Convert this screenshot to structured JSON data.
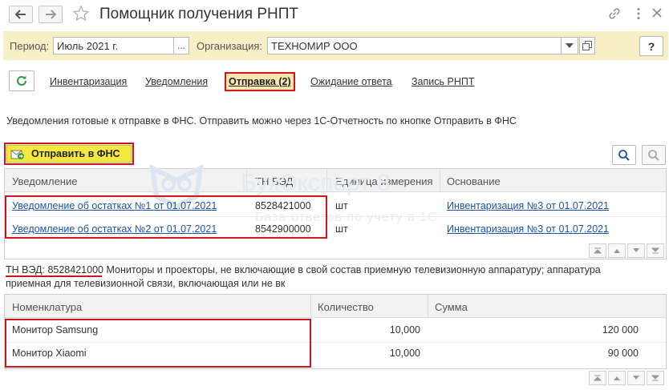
{
  "window": {
    "title": "Помощник получения РНПТ"
  },
  "filters": {
    "period_label": "Период:",
    "period_value": "Июль 2021 г.",
    "period_btn": "...",
    "org_label": "Организация:",
    "org_value": "ТЕХНОМИР ООО",
    "help_btn": "?"
  },
  "tabs": [
    {
      "label": "Инвентаризация"
    },
    {
      "label": "Уведомления"
    },
    {
      "label": "Отправка (2)"
    },
    {
      "label": "Ожидание ответа"
    },
    {
      "label": "Запись РНПТ"
    }
  ],
  "info_text": "Уведомления готовые к отправке в ФНС. Отправить можно через 1С-Отчетность по кнопке Отправить в ФНС",
  "send_button": "Отправить в ФНС",
  "watermark": {
    "title": "БухЭксперт 8",
    "subtitle": "База ответов по учету в 1С"
  },
  "notices_table": {
    "headers": [
      "Уведомление",
      "ТН ВЭД",
      "Единица измерения",
      "Основание"
    ],
    "rows": [
      {
        "notice": "Уведомление об остатках №1 от 01.07.2021",
        "tnved": "8528421000",
        "unit": "шт",
        "basis": "Инвентаризация №3 от 01.07.2021"
      },
      {
        "notice": "Уведомление об остатках №2 от 01.07.2021",
        "tnved": "8542900000",
        "unit": "шт",
        "basis": "Инвентаризация №3 от 01.07.2021"
      }
    ]
  },
  "tnved_desc": {
    "code_label": "ТН ВЭД: 8528421000",
    "line1": " Мониторы и проекторы, не включающие в свой состав приемную телевизионную аппаратуру; аппаратура",
    "line2": "приемная для телевизионной связи, включающая или не вк"
  },
  "items_table": {
    "headers": [
      "Номенклатура",
      "Количество",
      "Сумма"
    ],
    "rows": [
      {
        "name": "Монитор Samsung",
        "qty": "10,000",
        "sum": "120 000"
      },
      {
        "name": "Монитор Xiaomi",
        "qty": "10,000",
        "sum": "90 000"
      }
    ]
  },
  "colors": {
    "accent_red": "#d3141b",
    "send_yellow": "#f5e93e",
    "filter_panel": "#f7f0c6",
    "link_blue": "#1d54a6"
  }
}
